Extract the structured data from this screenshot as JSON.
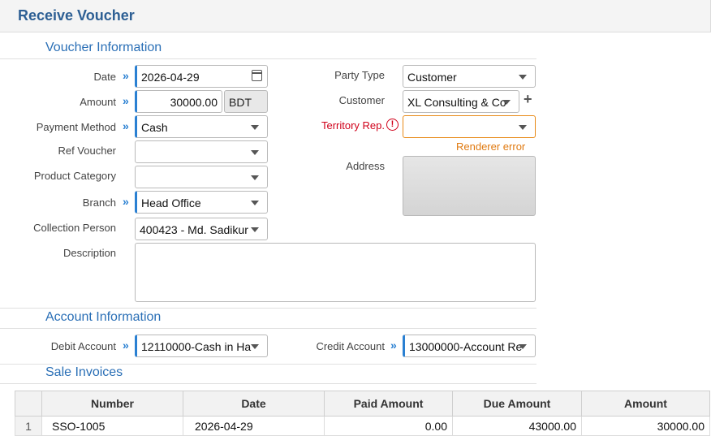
{
  "header": {
    "title": "Receive Voucher"
  },
  "sections": {
    "voucher_info": "Voucher Information",
    "account_info": "Account Information",
    "sale_invoices": "Sale Invoices"
  },
  "form": {
    "date": {
      "label": "Date",
      "value": "2026-04-29"
    },
    "amount": {
      "label": "Amount",
      "value": "30000.00",
      "currency": "BDT"
    },
    "payment_method": {
      "label": "Payment Method",
      "value": "Cash"
    },
    "ref_voucher": {
      "label": "Ref Voucher",
      "value": ""
    },
    "product_category": {
      "label": "Product Category",
      "value": ""
    },
    "branch": {
      "label": "Branch",
      "value": "Head Office"
    },
    "collection_person": {
      "label": "Collection Person",
      "value": "400423 - Md. Sadikur"
    },
    "description": {
      "label": "Description",
      "value": ""
    },
    "party_type": {
      "label": "Party Type",
      "value": "Customer"
    },
    "customer": {
      "label": "Customer",
      "value": "XL Consulting & Co"
    },
    "territory_rep": {
      "label": "Territory Rep.",
      "value": "",
      "error": "Renderer error"
    },
    "address": {
      "label": "Address"
    },
    "debit_account": {
      "label": "Debit Account",
      "value": "12110000-Cash in Ha"
    },
    "credit_account": {
      "label": "Credit Account",
      "value": "13000000-Account Re"
    }
  },
  "invoices": {
    "columns": [
      "Number",
      "Date",
      "Paid Amount",
      "Due Amount",
      "Amount"
    ],
    "rows": [
      {
        "index": "1",
        "number": "SSO-1005",
        "date": "2026-04-29",
        "paid": "0.00",
        "due": "43000.00",
        "amount": "30000.00"
      }
    ]
  },
  "colors": {
    "accent": "#2a80d2",
    "title": "#2d5f94",
    "error": "#d0021b",
    "warning": "#e07a10"
  },
  "icons": [
    "double-chevron-right-icon",
    "calendar-icon",
    "caret-down-icon",
    "plus-icon",
    "error-circle-icon"
  ]
}
